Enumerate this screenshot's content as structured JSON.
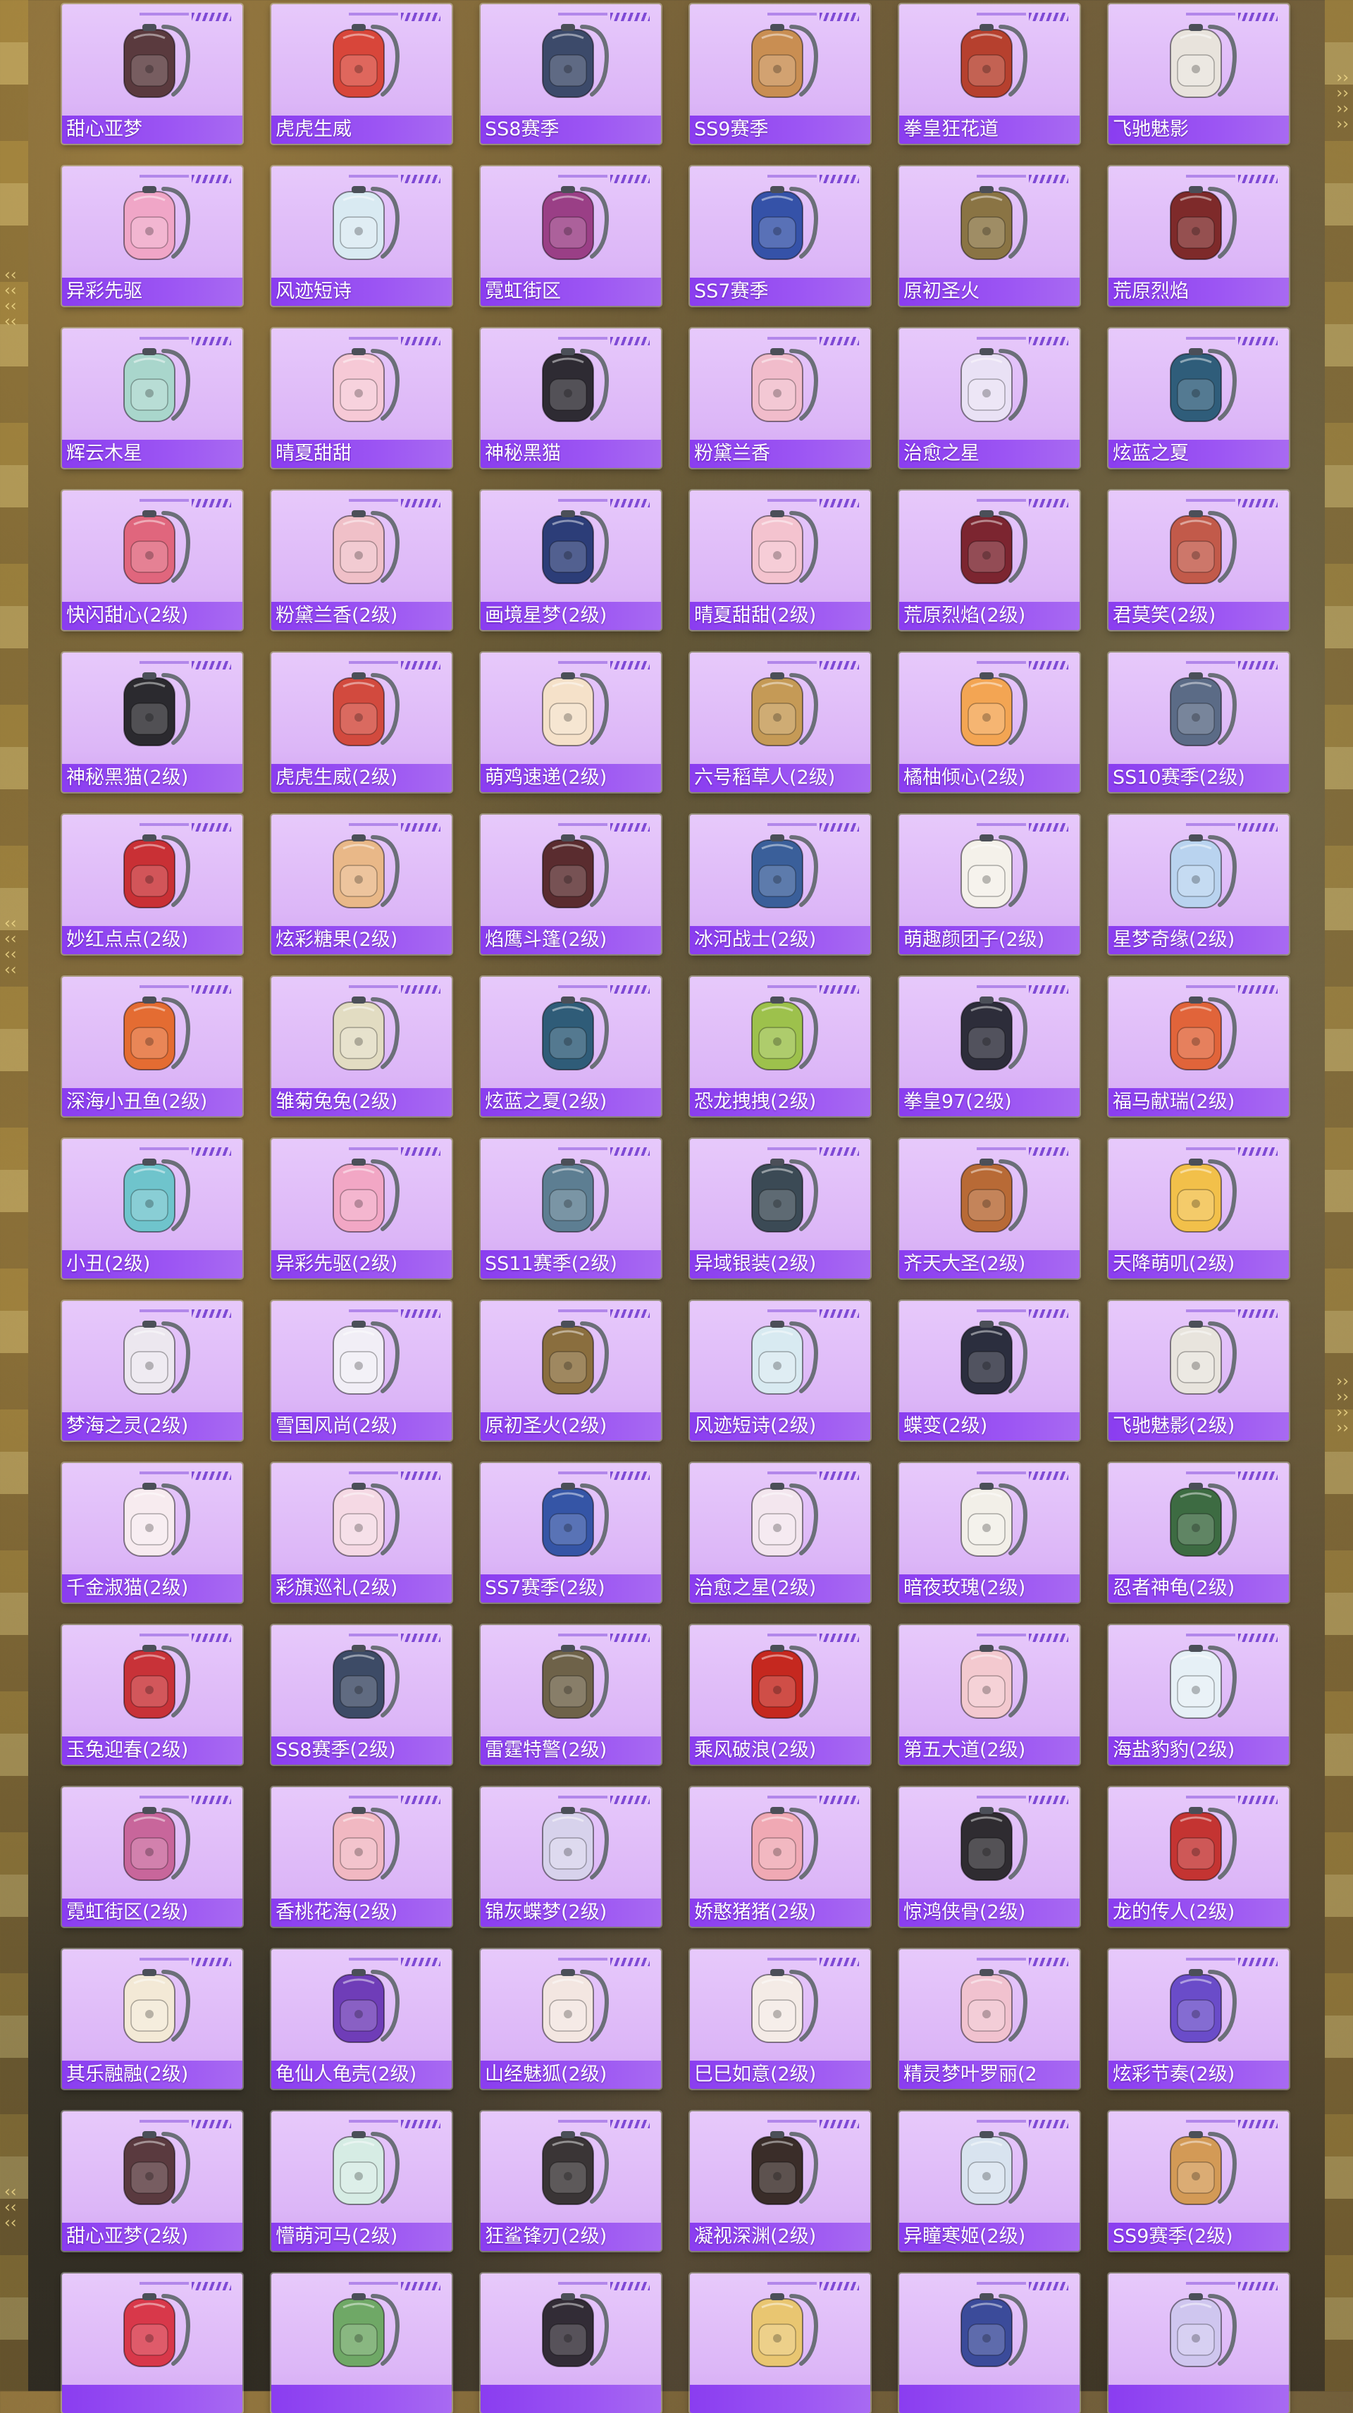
{
  "items": [
    {
      "name": "甜心亚梦",
      "color": "#5a3a3e"
    },
    {
      "name": "虎虎生威",
      "color": "#d8463a"
    },
    {
      "name": "SS8赛季",
      "color": "#3c4a6a"
    },
    {
      "name": "SS9赛季",
      "color": "#c98e52"
    },
    {
      "name": "拳皇狂花道",
      "color": "#b6402e"
    },
    {
      "name": "飞驰魅影",
      "color": "#e8e3dc"
    },
    {
      "name": "异彩先驱",
      "color": "#f0a6c7"
    },
    {
      "name": "风迹短诗",
      "color": "#d9eaf2"
    },
    {
      "name": "霓虹街区",
      "color": "#9a3f86"
    },
    {
      "name": "SS7赛季",
      "color": "#3552a8"
    },
    {
      "name": "原初圣火",
      "color": "#8a7444"
    },
    {
      "name": "荒原烈焰",
      "color": "#7e2a2a"
    },
    {
      "name": "辉云木星",
      "color": "#a9d6cc"
    },
    {
      "name": "晴夏甜甜",
      "color": "#f6c9d6"
    },
    {
      "name": "神秘黑猫",
      "color": "#2e2b33"
    },
    {
      "name": "粉黛兰香",
      "color": "#f1bccb"
    },
    {
      "name": "治愈之星",
      "color": "#e9e1f5"
    },
    {
      "name": "炫蓝之夏",
      "color": "#2f5d7a"
    },
    {
      "name": "快闪甜心(2级)",
      "color": "#e0667d"
    },
    {
      "name": "粉黛兰香(2级)",
      "color": "#f0c0c8"
    },
    {
      "name": "画境星梦(2级)",
      "color": "#2c3d78"
    },
    {
      "name": "晴夏甜甜(2级)",
      "color": "#f4c3cf"
    },
    {
      "name": "荒原烈焰(2级)",
      "color": "#7c2530"
    },
    {
      "name": "君莫笑(2级)",
      "color": "#c25a4a"
    },
    {
      "name": "神秘黑猫(2级)",
      "color": "#2b2a2f"
    },
    {
      "name": "虎虎生威(2级)",
      "color": "#d24a3e"
    },
    {
      "name": "萌鸡速递(2级)",
      "color": "#f5e1c9"
    },
    {
      "name": "六号稻草人(2级)",
      "color": "#c59a56"
    },
    {
      "name": "橘柚倾心(2级)",
      "color": "#f3a553"
    },
    {
      "name": "SS10赛季(2级)",
      "color": "#5b6b86"
    },
    {
      "name": "妙红点点(2级)",
      "color": "#c93035"
    },
    {
      "name": "炫彩糖果(2级)",
      "color": "#e9b888"
    },
    {
      "name": "焰鹰斗篷(2级)",
      "color": "#5a2c2f"
    },
    {
      "name": "冰河战士(2级)",
      "color": "#3a5f9a"
    },
    {
      "name": "萌趣颜团子(2级)",
      "color": "#f4f1ea"
    },
    {
      "name": "星梦奇缘(2级)",
      "color": "#b9d3ef"
    },
    {
      "name": "深海小丑鱼(2级)",
      "color": "#e46c32"
    },
    {
      "name": "雏菊兔兔(2级)",
      "color": "#e2dcc2"
    },
    {
      "name": "炫蓝之夏(2级)",
      "color": "#2f5c78"
    },
    {
      "name": "恐龙拽拽(2级)",
      "color": "#9dc14c"
    },
    {
      "name": "拳皇97(2级)",
      "color": "#2d2d3a"
    },
    {
      "name": "福马献瑞(2级)",
      "color": "#e1643a"
    },
    {
      "name": "小丑(2级)",
      "color": "#6fc4cc"
    },
    {
      "name": "异彩先驱(2级)",
      "color": "#f2a7c5"
    },
    {
      "name": "SS11赛季(2级)",
      "color": "#5d7e92"
    },
    {
      "name": "异域银装(2级)",
      "color": "#3b4a55"
    },
    {
      "name": "齐天大圣(2级)",
      "color": "#b86a36"
    },
    {
      "name": "天降萌叽(2级)",
      "color": "#f2c04a"
    },
    {
      "name": "梦海之灵(2级)",
      "color": "#ece7ef"
    },
    {
      "name": "雪国风尚(2级)",
      "color": "#f1eef6"
    },
    {
      "name": "原初圣火(2级)",
      "color": "#8a6e3e"
    },
    {
      "name": "风迹短诗(2级)",
      "color": "#d8eaf1"
    },
    {
      "name": "蝶变(2级)",
      "color": "#2b2e3e"
    },
    {
      "name": "飞驰魅影(2级)",
      "color": "#e8e4dd"
    },
    {
      "name": "千金淑猫(2级)",
      "color": "#f7ebef"
    },
    {
      "name": "彩旗巡礼(2级)",
      "color": "#f5d9e4"
    },
    {
      "name": "SS7赛季(2级)",
      "color": "#3555a6"
    },
    {
      "name": "治愈之星(2级)",
      "color": "#f3e6ee"
    },
    {
      "name": "暗夜玫瑰(2级)",
      "color": "#f2efe8"
    },
    {
      "name": "忍者神龟(2级)",
      "color": "#3d6b42"
    },
    {
      "name": "玉兔迎春(2级)",
      "color": "#c83238"
    },
    {
      "name": "SS8赛季(2级)",
      "color": "#3d4b66"
    },
    {
      "name": "雷霆特警(2级)",
      "color": "#6e6249"
    },
    {
      "name": "乘风破浪(2级)",
      "color": "#c5281f"
    },
    {
      "name": "第五大道(2级)",
      "color": "#f3c9cf"
    },
    {
      "name": "海盐豹豹(2级)",
      "color": "#e6f0f6"
    },
    {
      "name": "霓虹街区(2级)",
      "color": "#c8669b"
    },
    {
      "name": "香桃花海(2级)",
      "color": "#f1b8c2"
    },
    {
      "name": "锦灰蝶梦(2级)",
      "color": "#d7d2ec"
    },
    {
      "name": "娇憨猪猪(2级)",
      "color": "#f0a9b4"
    },
    {
      "name": "惊鸿侠骨(2级)",
      "color": "#2f2c31"
    },
    {
      "name": "龙的传人(2级)",
      "color": "#c43432"
    },
    {
      "name": "其乐融融(2级)",
      "color": "#f3e9d6"
    },
    {
      "name": "龟仙人龟壳(2级)",
      "color": "#6f3db8"
    },
    {
      "name": "山经魅狐(2级)",
      "color": "#f3e6e1"
    },
    {
      "name": "巳巳如意(2级)",
      "color": "#f4ebe6"
    },
    {
      "name": "精灵梦叶罗丽(2",
      "color": "#f1c2cf"
    },
    {
      "name": "炫彩节奏(2级)",
      "color": "#6a4cc9"
    },
    {
      "name": "甜心亚梦(2级)",
      "color": "#5a3a3f"
    },
    {
      "name": "懵萌河马(2级)",
      "color": "#d6ece4"
    },
    {
      "name": "狂鲨锋刃(2级)",
      "color": "#3a3536"
    },
    {
      "name": "凝视深渊(2级)",
      "color": "#3a2d29"
    },
    {
      "name": "异瞳寒姬(2级)",
      "color": "#d8e3ef"
    },
    {
      "name": "SS9赛季(2级)",
      "color": "#d39a56"
    },
    {
      "name": "",
      "color": "#d8384a"
    },
    {
      "name": "",
      "color": "#6fa866"
    },
    {
      "name": "",
      "color": "#322c36"
    },
    {
      "name": "",
      "color": "#e9c671"
    },
    {
      "name": "",
      "color": "#3b4b9a"
    },
    {
      "name": "",
      "color": "#cfc6ef"
    }
  ]
}
